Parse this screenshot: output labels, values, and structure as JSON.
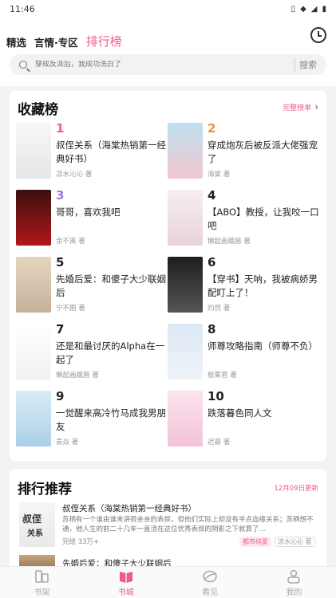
{
  "status": {
    "time": "11:46",
    "icons": [
      "vibrate-icon",
      "wifi-icon",
      "signal-icon",
      "battery-icon"
    ]
  },
  "nav": {
    "tabs": [
      {
        "label": "精选",
        "active": false
      },
      {
        "label": "言情·专区",
        "active": false
      },
      {
        "label": "排行榜",
        "active": true
      }
    ],
    "history_icon": "clock-icon"
  },
  "search": {
    "placeholder": "穿成反派后，我成功洗白了",
    "button": "搜索"
  },
  "fav_rank": {
    "title": "收藏榜",
    "more": "完整榜单",
    "items": [
      {
        "rank": "1",
        "title": "叔侄关系（海棠热销第一经典好书）",
        "author": "凉水沁沁 著",
        "color": "#ec5b8f"
      },
      {
        "rank": "2",
        "title": "穿成炮灰后被反派大佬强宠了",
        "author": "海棠 著",
        "color": "#f0913b"
      },
      {
        "rank": "3",
        "title": "哥哥，喜欢我吧",
        "author": "余不离 著",
        "color": "#9a7bd8"
      },
      {
        "rank": "4",
        "title": "【ABO】教授，让我咬一口吧",
        "author": "懒起画蛾眉 著",
        "color": "#222222"
      },
      {
        "rank": "5",
        "title": "先婚后爱：和傻子大少联姻后",
        "author": "宁不图 著",
        "color": "#222222"
      },
      {
        "rank": "6",
        "title": "【穿书】天呐，我被病娇男配盯上了！",
        "author": "灼然 著",
        "color": "#222222"
      },
      {
        "rank": "7",
        "title": "还是和最讨厌的Alpha在一起了",
        "author": "懒起画蛾眉 著",
        "color": "#222222"
      },
      {
        "rank": "8",
        "title": "师尊攻略指南（师尊不负）",
        "author": "板栗君 著",
        "color": "#222222"
      },
      {
        "rank": "9",
        "title": "一觉醒来高冷竹马成我男朋友",
        "author": "袁焱 著",
        "color": "#222222"
      },
      {
        "rank": "10",
        "title": "跌落暮色同人文",
        "author": "迟暮 著",
        "color": "#222222"
      }
    ]
  },
  "recommend": {
    "title": "排行推荐",
    "date": "12月09日更新",
    "item": {
      "title": "叔侄关系（海棠热销第一经典好书）",
      "desc": "苏柄有一个谁由谁来讲很亲亲的表叔，但他们实际上却没有半点血缘关系；苏柄想不通，他人生的前二十几年一直活在这位优秀表叔的阴影之下就算了...",
      "meta": "完结 33万+",
      "tag": "都市纯爱",
      "author": "凉水沁沁 著"
    },
    "item2_title": "先婚后爱：和傻子大少联姻后"
  },
  "bottom_nav": [
    {
      "label": "书架",
      "icon": "bookshelf-icon",
      "active": false
    },
    {
      "label": "书城",
      "icon": "open-book-icon",
      "active": true
    },
    {
      "label": "看见",
      "icon": "leaf-icon",
      "active": false
    },
    {
      "label": "我的",
      "icon": "person-icon",
      "active": false
    }
  ]
}
